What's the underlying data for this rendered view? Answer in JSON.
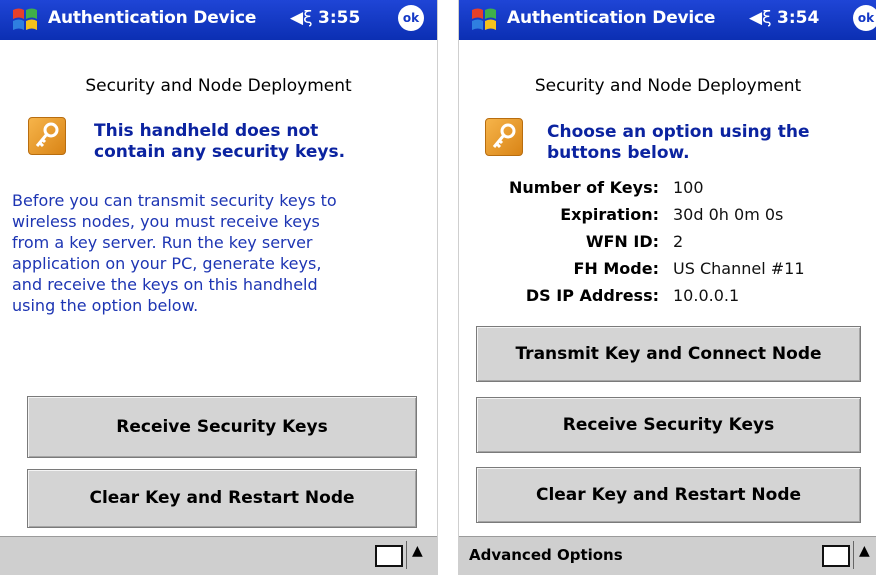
{
  "screens": [
    {
      "titlebar": {
        "title": "Authentication Device",
        "time": "3:55",
        "ok": "ok",
        "speaker_glyph": "◀ξ"
      },
      "heading": "Security and Node Deployment",
      "message_line1": "This handheld does not",
      "message_line2": "contain any security keys.",
      "body_lines": [
        "Before you can transmit security keys to",
        "wireless nodes, you must receive keys",
        "from a key server.  Run the key server",
        "application on your PC, generate keys,",
        "and receive the keys on this handheld",
        "using the option below."
      ],
      "buttons": [
        {
          "label": "Receive Security Keys"
        },
        {
          "label": "Clear Key and Restart Node"
        }
      ],
      "bottombar": {
        "up_glyph": "▲"
      }
    },
    {
      "titlebar": {
        "title": "Authentication Device",
        "time": "3:54",
        "ok": "ok",
        "speaker_glyph": "◀ξ"
      },
      "heading": "Security and Node Deployment",
      "message_line1": "Choose an option using the",
      "message_line2": "buttons below.",
      "info": [
        {
          "label": "Number of Keys:",
          "value": "100"
        },
        {
          "label": "Expiration:",
          "value": "30d 0h 0m 0s"
        },
        {
          "label": "WFN ID:",
          "value": "2"
        },
        {
          "label": "FH Mode:",
          "value": "US Channel #11"
        },
        {
          "label": "DS IP Address:",
          "value": "10.0.0.1"
        }
      ],
      "buttons": [
        {
          "label": "Transmit Key and Connect Node"
        },
        {
          "label": "Receive Security Keys"
        },
        {
          "label": "Clear Key and Restart Node"
        }
      ],
      "bottombar": {
        "menu_label": "Advanced Options",
        "up_glyph": "▲"
      }
    }
  ],
  "colors": {
    "titlebar": "#0b2fb3",
    "message_text": "#0b23a0",
    "body_text": "#1d35b3",
    "button_face": "#d4d4d4",
    "key_icon": "#f6b44a"
  }
}
